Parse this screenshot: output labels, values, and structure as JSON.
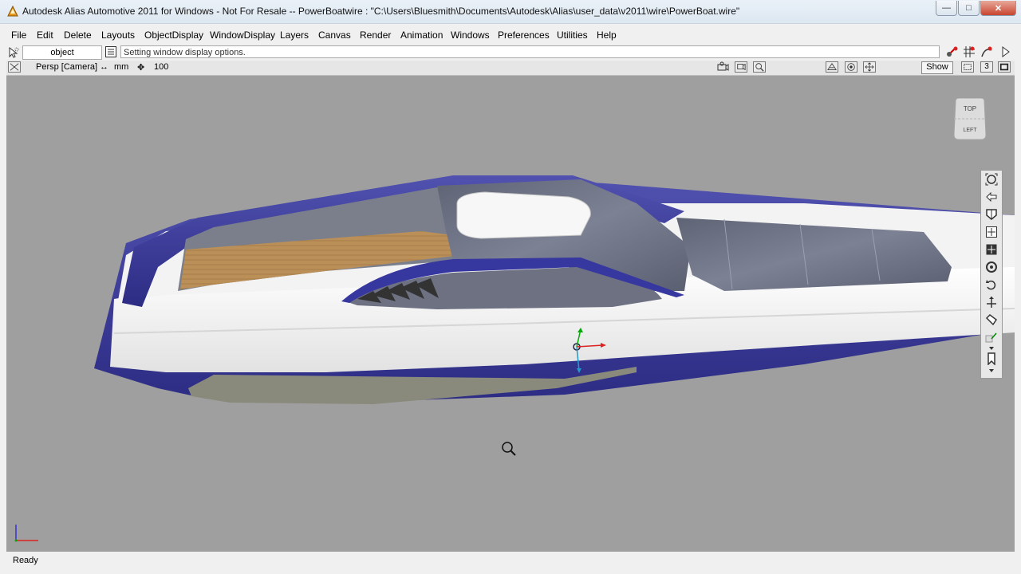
{
  "window": {
    "title": "Autodesk Alias Automotive 2011  for Windows - Not For Resale  --  PowerBoatwire : \"C:\\Users\\Bluesmith\\Documents\\Autodesk\\Alias\\user_data\\v2011\\wire\\PowerBoat.wire\"",
    "minimize_icon": "minimize-icon",
    "maximize_icon": "maximize-icon",
    "close_icon": "close-icon"
  },
  "menu": {
    "items": [
      "File",
      "Edit",
      "Delete",
      "Layouts",
      "ObjectDisplay",
      "WindowDisplay",
      "Layers",
      "Canvas",
      "Render",
      "Animation",
      "Windows",
      "Preferences",
      "Utilities",
      "Help"
    ]
  },
  "prompt": {
    "object_field": "object",
    "message": "Setting window display options."
  },
  "view": {
    "camera_label": "Persp [Camera]",
    "unit_label": "mm",
    "grid_value": "100",
    "show_button": "Show",
    "layout_number": "3"
  },
  "viewcube": {
    "top": "TOP",
    "left": "LEFT"
  },
  "status": {
    "text": "Ready"
  },
  "colors": {
    "viewport_bg": "#9f9f9f",
    "hull_blue": "#3a3a9e",
    "hull_white": "#f4f4f4",
    "deck_wood": "#b98f58",
    "glass": "#6e7384"
  }
}
